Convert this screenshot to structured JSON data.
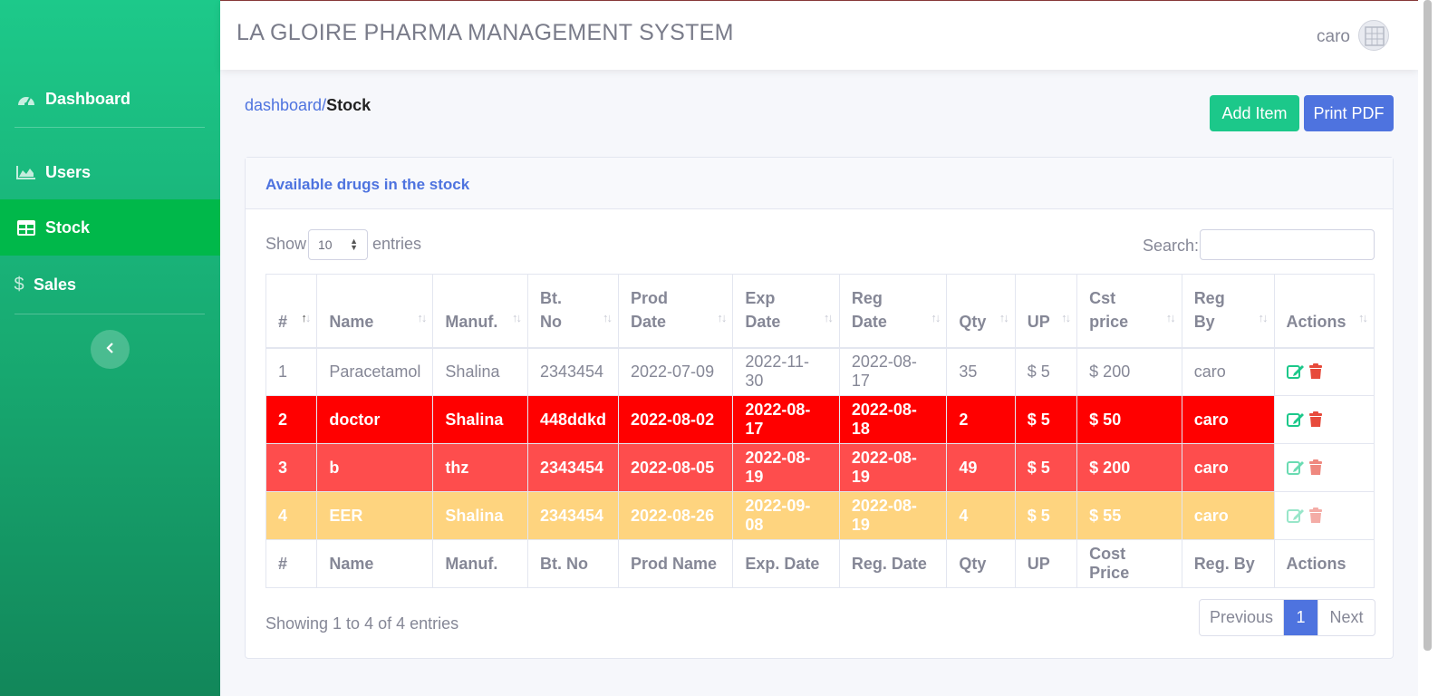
{
  "app": {
    "title": "LA GLOIRE PHARMA MANAGEMENT SYSTEM",
    "user": "caro"
  },
  "sidebar": {
    "items": [
      {
        "label": "Dashboard",
        "icon": "gauge-icon",
        "active": false
      },
      {
        "label": "Users",
        "icon": "area-chart-icon",
        "active": false
      },
      {
        "label": "Stock",
        "icon": "table-icon",
        "active": true
      },
      {
        "label": "Sales",
        "icon": "dollar-icon",
        "active": false
      }
    ]
  },
  "breadcrumb": {
    "link": "dashboard",
    "separator": "/",
    "current": "Stock"
  },
  "actions": {
    "add_label": "Add Item",
    "pdf_label": "Print PDF"
  },
  "card": {
    "title": "Available drugs in the stock",
    "show_label": "Show",
    "page_size": "10",
    "entries_label": "entries",
    "search_label": "Search:",
    "search_value": ""
  },
  "table": {
    "headers": [
      [
        "#"
      ],
      [
        "Name"
      ],
      [
        "Manuf."
      ],
      [
        "Bt.",
        "No"
      ],
      [
        "Prod",
        "Date"
      ],
      [
        "Exp",
        "Date"
      ],
      [
        "Reg",
        "Date"
      ],
      [
        "Qty"
      ],
      [
        "UP"
      ],
      [
        "Cst",
        "price"
      ],
      [
        "Reg",
        "By"
      ],
      [
        "Actions"
      ]
    ],
    "rows": [
      {
        "status": "normal",
        "cells": [
          "1",
          "Paracetamol",
          "Shalina",
          "2343454",
          "2022-07-09",
          "2022-11-30",
          "2022-08-17",
          "35",
          "$ 5",
          "$ 200",
          "caro"
        ]
      },
      {
        "status": "expired",
        "cells": [
          "2",
          "doctor",
          "Shalina",
          "448ddkd",
          "2022-08-02",
          "2022-08-17",
          "2022-08-18",
          "2",
          "$ 5",
          "$ 50",
          "caro"
        ]
      },
      {
        "status": "expiring",
        "cells": [
          "3",
          "b",
          "thz",
          "2343454",
          "2022-08-05",
          "2022-08-19",
          "2022-08-19",
          "49",
          "$ 5",
          "$ 200",
          "caro"
        ]
      },
      {
        "status": "warning",
        "cells": [
          "4",
          "EER",
          "Shalina",
          "2343454",
          "2022-08-26",
          "2022-09-08",
          "2022-08-19",
          "4",
          "$ 5",
          "$ 55",
          "caro"
        ]
      }
    ],
    "footers": [
      "#",
      "Name",
      "Manuf.",
      "Bt. No",
      "Prod Name",
      "Exp. Date",
      "Reg. Date",
      "Qty",
      "UP",
      "Cost Price",
      "Reg. By",
      "Actions"
    ],
    "row_colors": {
      "expired": "#ff0000",
      "expiring": "#fe4d4d",
      "warning": "#fed47f"
    }
  },
  "pagination": {
    "info": "Showing 1 to 4 of 4 entries",
    "prev": "Previous",
    "current": "1",
    "next": "Next"
  },
  "colors": {
    "primary": "#4e73df",
    "success": "#1cc88a",
    "danger": "#e74a3b",
    "sidebar_active": "#00b84a"
  }
}
